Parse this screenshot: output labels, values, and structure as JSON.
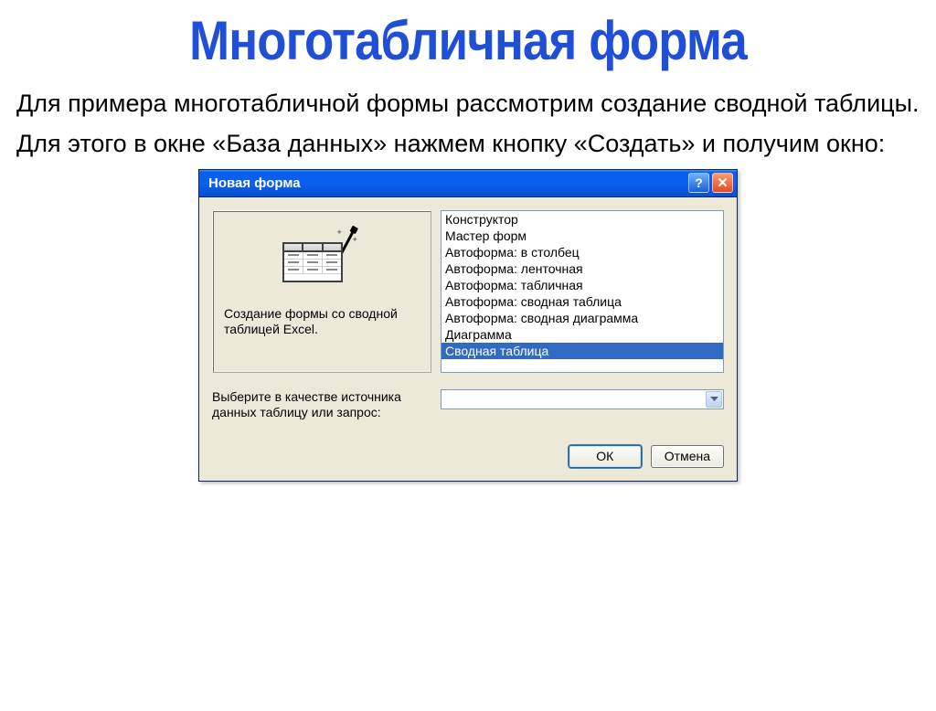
{
  "title": "Многотабличная форма",
  "paragraph1": "Для примера многотабличной формы рассмотрим создание сводной таблицы.",
  "paragraph2": "Для этого в окне «База данных» нажмем кнопку «Создать» и получим окно:",
  "dialog": {
    "title": "Новая форма",
    "left_desc": "Создание формы со сводной таблицей Excel.",
    "list": [
      "Конструктор",
      "Мастер форм",
      "Автоформа: в столбец",
      "Автоформа: ленточная",
      "Автоформа: табличная",
      "Автоформа:  сводная таблица",
      "Автоформа:  сводная диаграмма",
      "Диаграмма",
      "Сводная таблица"
    ],
    "selected_index": 8,
    "source_label": "Выберите в качестве источника данных таблицу или запрос:",
    "combo_value": "",
    "ok": "ОК",
    "cancel": "Отмена"
  }
}
